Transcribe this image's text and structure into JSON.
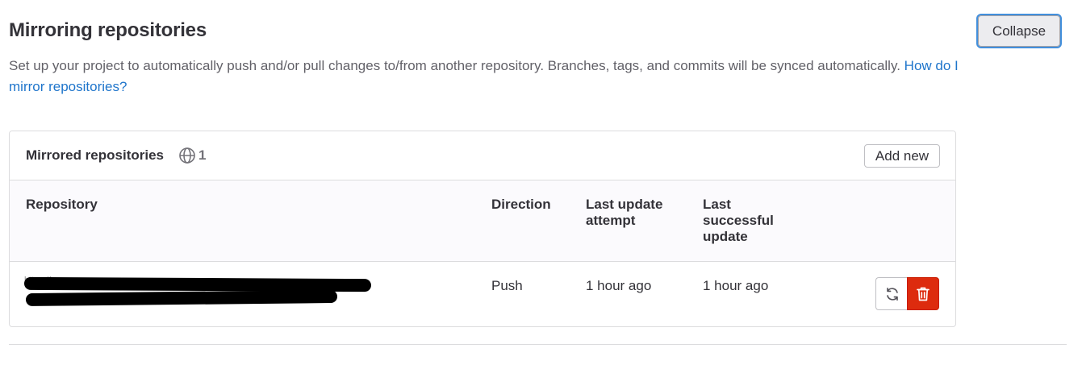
{
  "section": {
    "title": "Mirroring repositories",
    "collapse_label": "Collapse",
    "description": "Set up your project to automatically push and/or pull changes to/from another repository. Branches, tags, and commits will be synced automatically.",
    "help_link": "How do I mirror repositories?"
  },
  "mirrored": {
    "title": "Mirrored repositories",
    "count": "1",
    "add_new_label": "Add new",
    "columns": {
      "repository": "Repository",
      "direction": "Direction",
      "last_attempt": "Last update attempt",
      "last_success": "Last successful update"
    },
    "rows": [
      {
        "repository_line1": "https://",
        "repository_line2": "",
        "direction": "Push",
        "last_attempt": "1 hour ago",
        "last_success": "1 hour ago"
      }
    ]
  },
  "icons": {
    "globe": "globe-icon",
    "sync": "sync-icon",
    "delete": "trash-icon"
  },
  "colors": {
    "link": "#1f75cb",
    "danger": "#dd2b0e",
    "focus_ring": "#428fdc"
  }
}
